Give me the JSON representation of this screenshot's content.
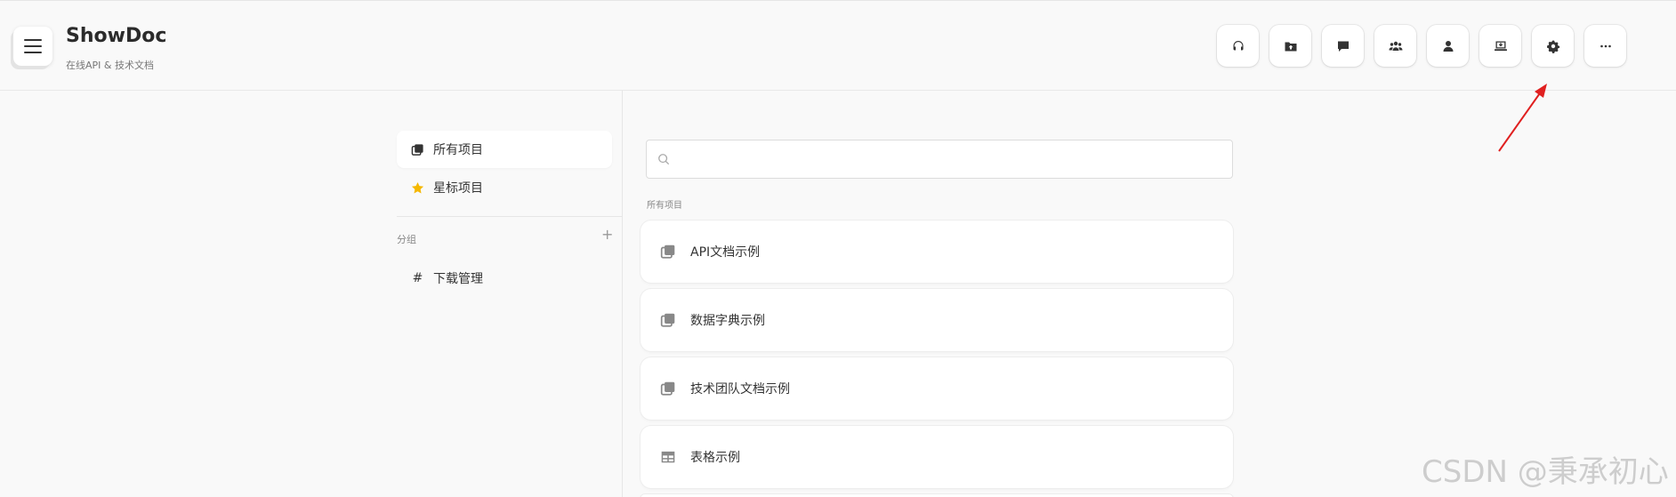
{
  "app": {
    "title": "ShowDoc",
    "subtitle": "在线API & 技术文档"
  },
  "toolbar": {
    "buttons": [
      {
        "icon": "headset-icon"
      },
      {
        "icon": "folder-upload-icon"
      },
      {
        "icon": "chat-icon"
      },
      {
        "icon": "team-icon"
      },
      {
        "icon": "user-icon"
      },
      {
        "icon": "download-icon"
      },
      {
        "icon": "gear-icon"
      },
      {
        "icon": "more-icon"
      }
    ]
  },
  "sidebar": {
    "items": [
      {
        "label": "所有项目",
        "icon": "projects-icon",
        "active": true
      },
      {
        "label": "星标项目",
        "icon": "star-icon",
        "active": false
      }
    ],
    "group_label": "分组",
    "group_add": "+",
    "groups": [
      {
        "label": "下载管理",
        "icon": "hash"
      }
    ]
  },
  "search": {
    "placeholder": "",
    "value": ""
  },
  "main": {
    "section_label": "所有项目",
    "projects": [
      {
        "label": "API文档示例",
        "icon": "project-icon"
      },
      {
        "label": "数据字典示例",
        "icon": "project-icon"
      },
      {
        "label": "技术团队文档示例",
        "icon": "project-icon"
      },
      {
        "label": "表格示例",
        "icon": "table-icon"
      }
    ]
  },
  "watermark": "CSDN @秉承初心",
  "colors": {
    "star": "#f5b800",
    "arrow": "#e02020",
    "background": "#f9f9f9"
  }
}
